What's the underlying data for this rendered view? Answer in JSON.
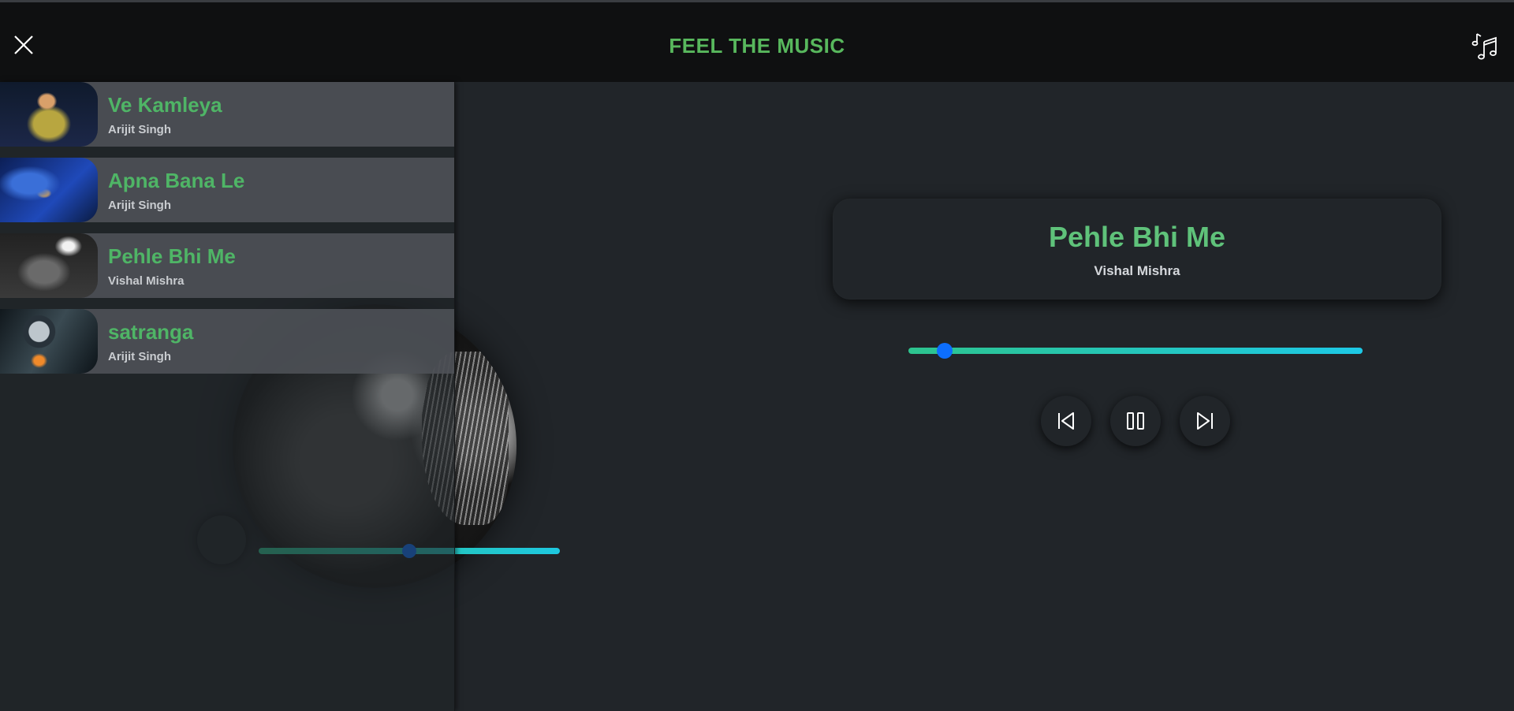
{
  "header": {
    "title": "FEEL THE MUSIC",
    "close_icon": "close-icon",
    "playlist_icon": "music-notes-icon"
  },
  "playlist": [
    {
      "title": "Ve Kamleya",
      "artist": "Arijit Singh"
    },
    {
      "title": "Apna Bana Le",
      "artist": "Arijit Singh"
    },
    {
      "title": "Pehle Bhi Me",
      "artist": "Vishal Mishra"
    },
    {
      "title": "satranga",
      "artist": "Arijit Singh"
    }
  ],
  "now_playing": {
    "title": "Pehle Bhi Me",
    "artist": "Vishal Mishra",
    "progress": 0.08
  },
  "controls": {
    "prev_icon": "skip-previous-icon",
    "pause_icon": "pause-icon",
    "next_icon": "skip-next-icon"
  },
  "colors": {
    "accent": "#58b85d",
    "progress_start": "#2dc48e",
    "progress_end": "#1dc9e6",
    "thumb": "#0d6efd",
    "background": "#212529"
  }
}
